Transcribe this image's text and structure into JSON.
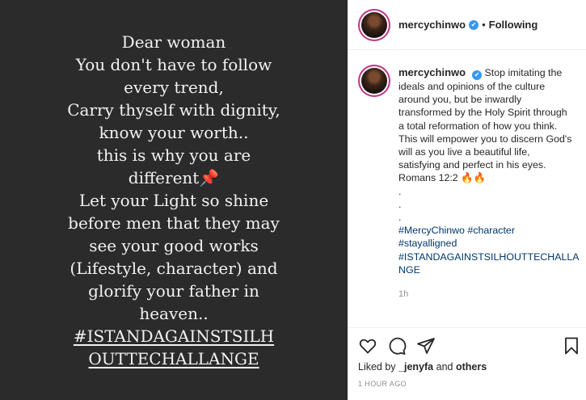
{
  "post_image": {
    "lines": [
      "Dear woman",
      "You don't have to follow",
      "every trend,",
      "Carry thyself with dignity,",
      "know your worth..",
      "this is why you are",
      "different",
      "Let your Light so shine",
      "before men that they may",
      "see your good works",
      "(Lifestyle, character) and",
      "glorify your father in",
      "heaven..",
      "#ISTANDAGAINSTSILH",
      "OUTTECHALLANGE"
    ],
    "emoji": "📌"
  },
  "header": {
    "username": "mercychinwo",
    "verified_mark": "✔",
    "dot": "•",
    "following_label": "Following"
  },
  "caption": {
    "username": "mercychinwo",
    "text": "Stop imitating the ideals and opinions of the culture around you, but be inwardly transformed by the Holy Spirit through a total reformation of how you think. This will empower you to discern God's will as you live a beautiful life, satisfying and perfect in his eyes.",
    "reference": "Romans 12:2 🔥🔥",
    "dots": [
      ".",
      ".",
      "."
    ],
    "hashtags": [
      "#MercyChinwo",
      "#character",
      "#stayalligned",
      "#ISTANDAGAINSTSILHOUTTECHALLA",
      "NGE"
    ],
    "time": "1h"
  },
  "likes": {
    "prefix": "Liked by",
    "user": "_jenyfa",
    "conjunction": "and",
    "others": "others"
  },
  "timestamp": "1 HOUR AGO",
  "icons": {
    "like": "heart-icon",
    "comment": "comment-icon",
    "share": "share-icon",
    "save": "bookmark-icon"
  }
}
